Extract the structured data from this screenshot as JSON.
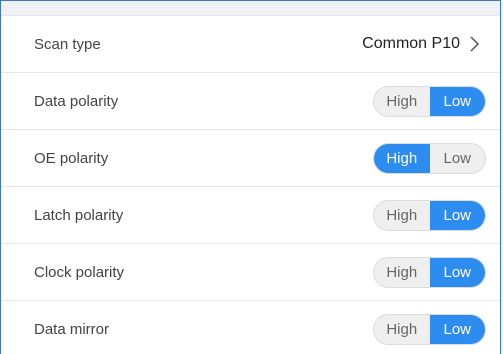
{
  "scan_type": {
    "label": "Scan type",
    "value": "Common P10"
  },
  "settings": [
    {
      "label": "Data polarity",
      "options": [
        "High",
        "Low"
      ],
      "selected": "Low"
    },
    {
      "label": "OE polarity",
      "options": [
        "High",
        "Low"
      ],
      "selected": "High"
    },
    {
      "label": "Latch polarity",
      "options": [
        "High",
        "Low"
      ],
      "selected": "Low"
    },
    {
      "label": "Clock polarity",
      "options": [
        "High",
        "Low"
      ],
      "selected": "Low"
    },
    {
      "label": "Data mirror",
      "options": [
        "High",
        "Low"
      ],
      "selected": "Low"
    }
  ],
  "colors": {
    "accent": "#2d8cf0",
    "border": "#3c78c8"
  },
  "icons": {
    "scan_type_arrow": "chevron-right-icon"
  }
}
